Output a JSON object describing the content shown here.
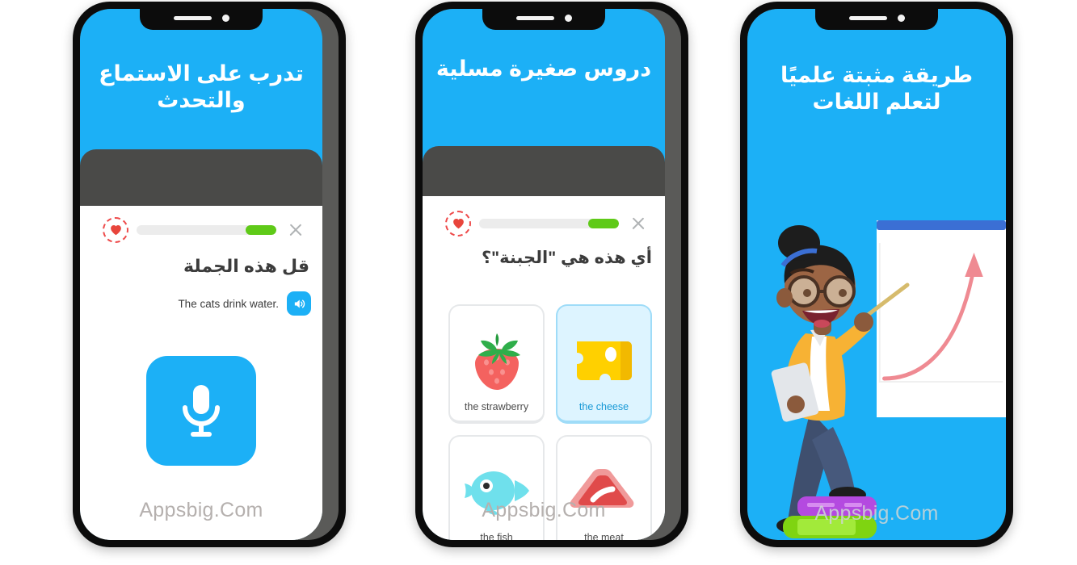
{
  "meta": {
    "watermark": "Appsbig.Com",
    "colors": {
      "brand_blue": "#1CB0F6",
      "frame_black": "#0c0c0c",
      "bezel_grey": "#5a5a58",
      "lesson_band_grey": "#4a4a48",
      "progress_green": "#5fca18",
      "heart_red": "#e8453c",
      "selected_tile_bg": "#ddf4ff",
      "selected_tile_text": "#1899d6",
      "board_header_blue": "#3b6fd4",
      "arrow_pink": "#ef8a92"
    }
  },
  "phones": [
    {
      "id": "phone-listen-speak",
      "hero_lines": [
        "تدرب على الاستماع",
        "والتحدث"
      ],
      "lesson": {
        "heart_icon": "heart-icon",
        "progress_percent": 22,
        "close_icon": "close-icon",
        "prompt": "قل هذه الجملة",
        "sentence": "The cats drink water.",
        "speaker_icon": "speaker-icon",
        "mic_icon": "microphone-icon"
      }
    },
    {
      "id": "phone-fun-lessons",
      "hero_lines": [
        "دروس صغيرة مسلية"
      ],
      "lesson": {
        "heart_icon": "heart-icon",
        "progress_percent": 22,
        "close_icon": "close-icon",
        "prompt": "أي هذه هي \"الجبنة\"؟",
        "choices": [
          {
            "label": "the strawberry",
            "art": "strawberry-icon",
            "selected": false
          },
          {
            "label": "the cheese",
            "art": "cheese-icon",
            "selected": true
          },
          {
            "label": "the fish",
            "art": "fish-icon",
            "selected": false
          },
          {
            "label": "the meat",
            "art": "meat-icon",
            "selected": false
          }
        ]
      }
    },
    {
      "id": "phone-scientific-method",
      "hero_lines": [
        "طريقة مثبتة علميًا",
        "لتعلم اللغات"
      ],
      "illustration": {
        "name": "teacher-pointing-at-growth-chart-illustration",
        "elements": [
          "whiteboard",
          "rising-arrow-chart",
          "teacher-character",
          "pointer-stick",
          "stacked-books"
        ]
      }
    }
  ]
}
